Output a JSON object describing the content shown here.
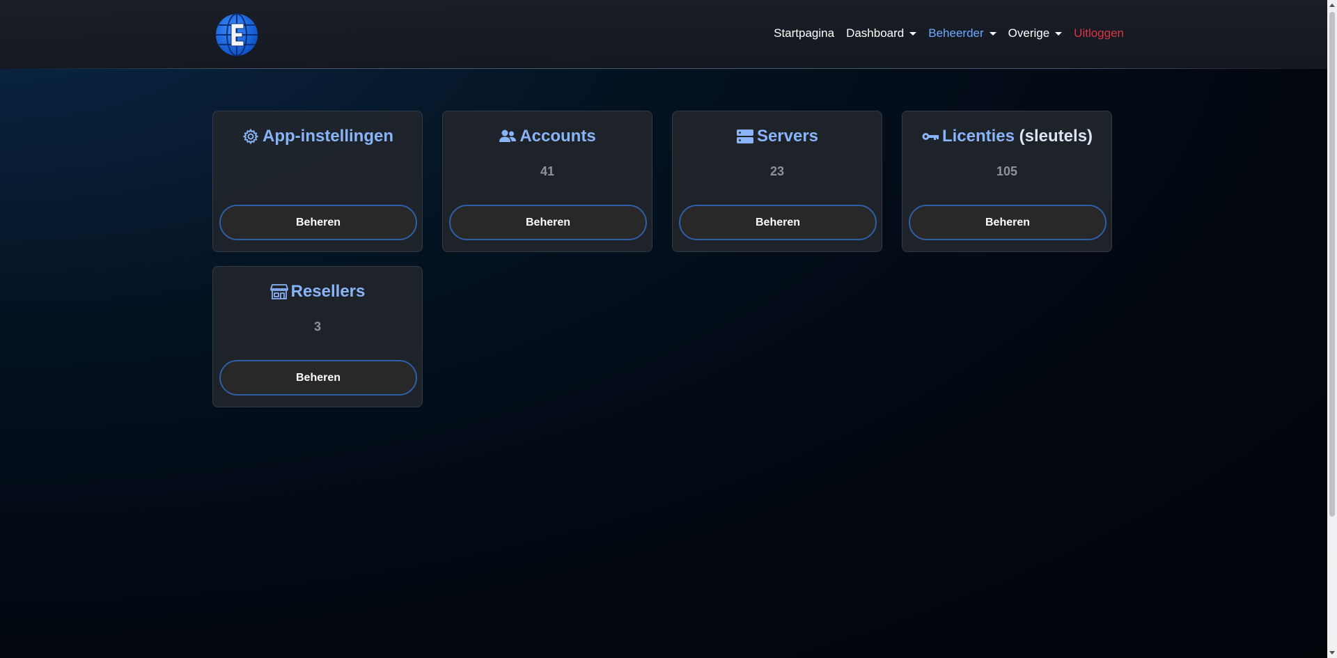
{
  "nav": {
    "items": [
      {
        "label": "Startpagina",
        "style": "white",
        "dropdown": false
      },
      {
        "label": "Dashboard",
        "style": "white",
        "dropdown": true
      },
      {
        "label": "Beheerder",
        "style": "active",
        "dropdown": true
      },
      {
        "label": "Overige",
        "style": "white",
        "dropdown": true
      },
      {
        "label": "Uitloggen",
        "style": "danger",
        "dropdown": false
      }
    ]
  },
  "cards": [
    {
      "icon": "gear-icon",
      "title": "App-instellingen",
      "title_light": "",
      "count": "",
      "button": "Beheren"
    },
    {
      "icon": "users-icon",
      "title": "Accounts",
      "title_light": "",
      "count": "41",
      "button": "Beheren"
    },
    {
      "icon": "server-icon",
      "title": "Servers",
      "title_light": "",
      "count": "23",
      "button": "Beheren"
    },
    {
      "icon": "key-icon",
      "title": "Licenties",
      "title_light": " (sleutels)",
      "count": "105",
      "button": "Beheren"
    },
    {
      "icon": "shop-icon",
      "title": "Resellers",
      "title_light": "",
      "count": "3",
      "button": "Beheren"
    }
  ],
  "colors": {
    "accent": "#8ab4f8",
    "nav_active": "#6ea8fe",
    "nav_danger": "#dc3545",
    "button_border": "#2f5fa8"
  }
}
